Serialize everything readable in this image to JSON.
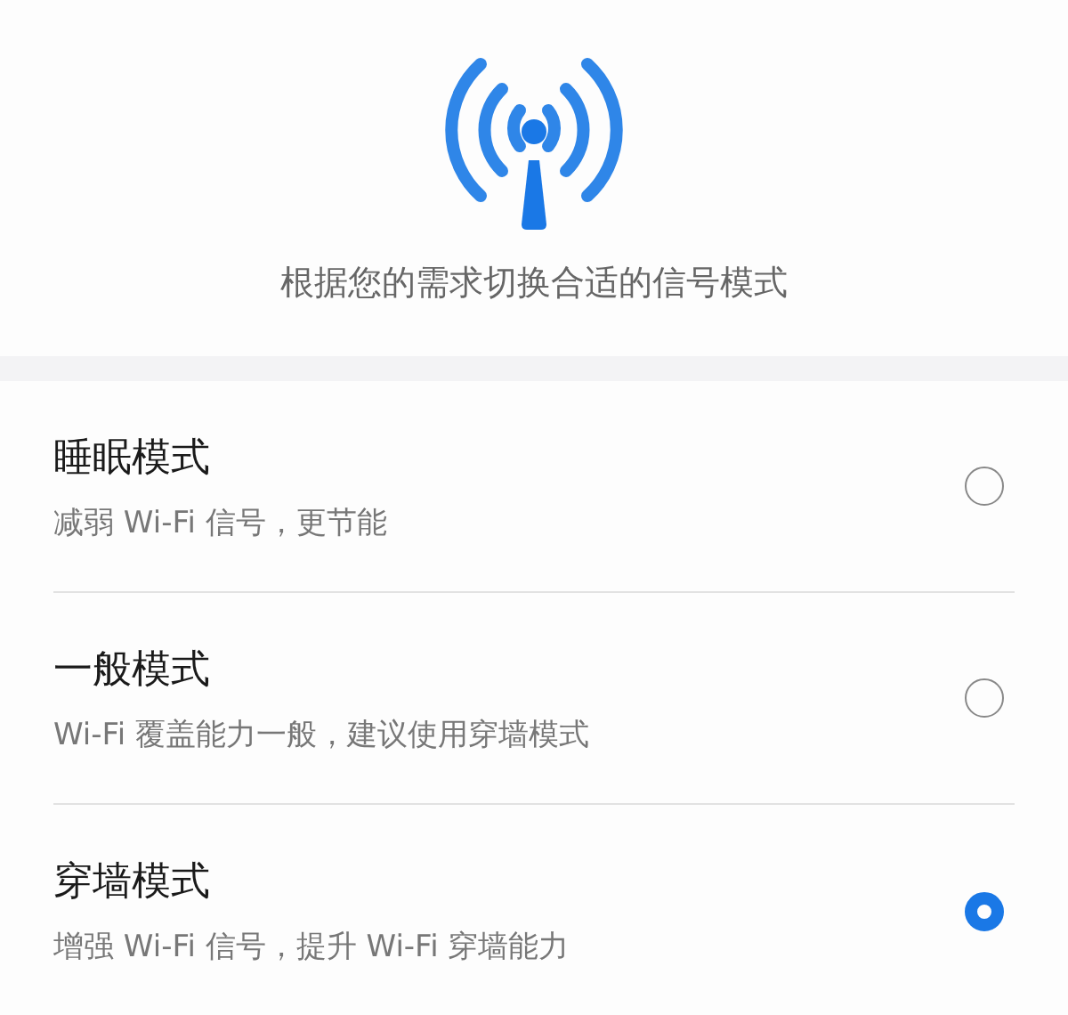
{
  "header": {
    "description": "根据您的需求切换合适的信号模式"
  },
  "modes": [
    {
      "title": "睡眠模式",
      "subtitle": "减弱 Wi-Fi 信号，更节能",
      "selected": false
    },
    {
      "title": "一般模式",
      "subtitle": "Wi-Fi 覆盖能力一般，建议使用穿墙模式",
      "selected": false
    },
    {
      "title": "穿墙模式",
      "subtitle": "增强 Wi-Fi 信号，提升 Wi-Fi 穿墙能力",
      "selected": true
    }
  ]
}
